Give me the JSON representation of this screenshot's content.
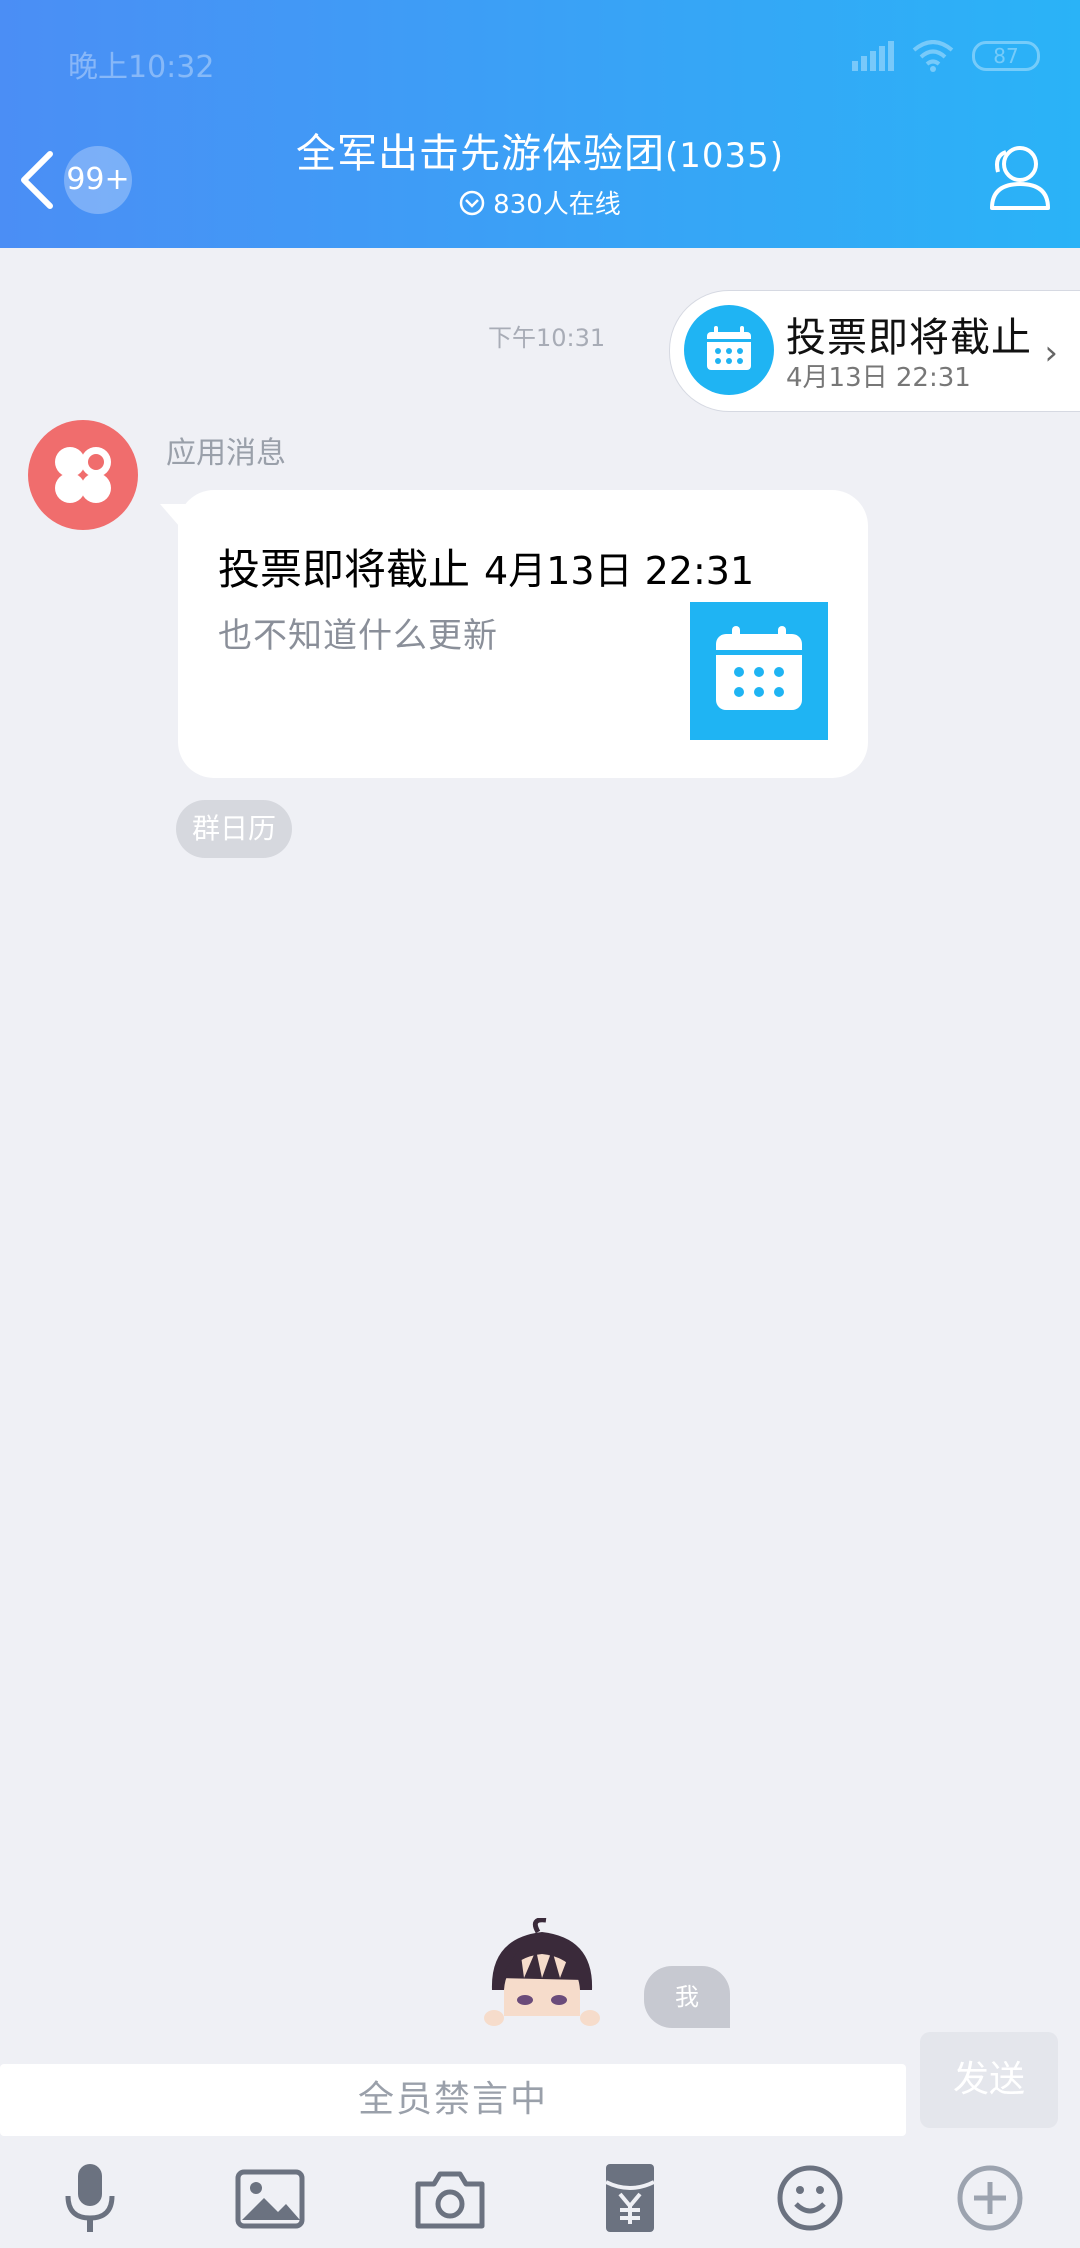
{
  "status_bar": {
    "time": "晚上10:32",
    "battery": "87"
  },
  "header": {
    "unread_badge": "99+",
    "group_name": "全军出击先游体验团",
    "member_count": "(1035)",
    "online_text": "830人在线"
  },
  "announcement": {
    "title": "投票即将截止",
    "date": "4月13日 22:31"
  },
  "chat": {
    "timestamp": "下午10:31",
    "sender_name": "应用消息",
    "message": {
      "title": "投票即将截止",
      "date": "4月13日 22:31",
      "description": "也不知道什么更新"
    },
    "source_chip": "群日历"
  },
  "bottom": {
    "me_label": "我",
    "input_placeholder": "全员禁言中",
    "send_label": "发送"
  },
  "toolbar_icons": [
    "microphone-icon",
    "image-icon",
    "camera-icon",
    "red-packet-icon",
    "emoji-icon",
    "plus-icon"
  ],
  "colors": {
    "header_start": "#4b8ef5",
    "header_end": "#2ab3f7",
    "calendar_blue": "#1fb4f3",
    "app_avatar": "#f06d6d"
  }
}
